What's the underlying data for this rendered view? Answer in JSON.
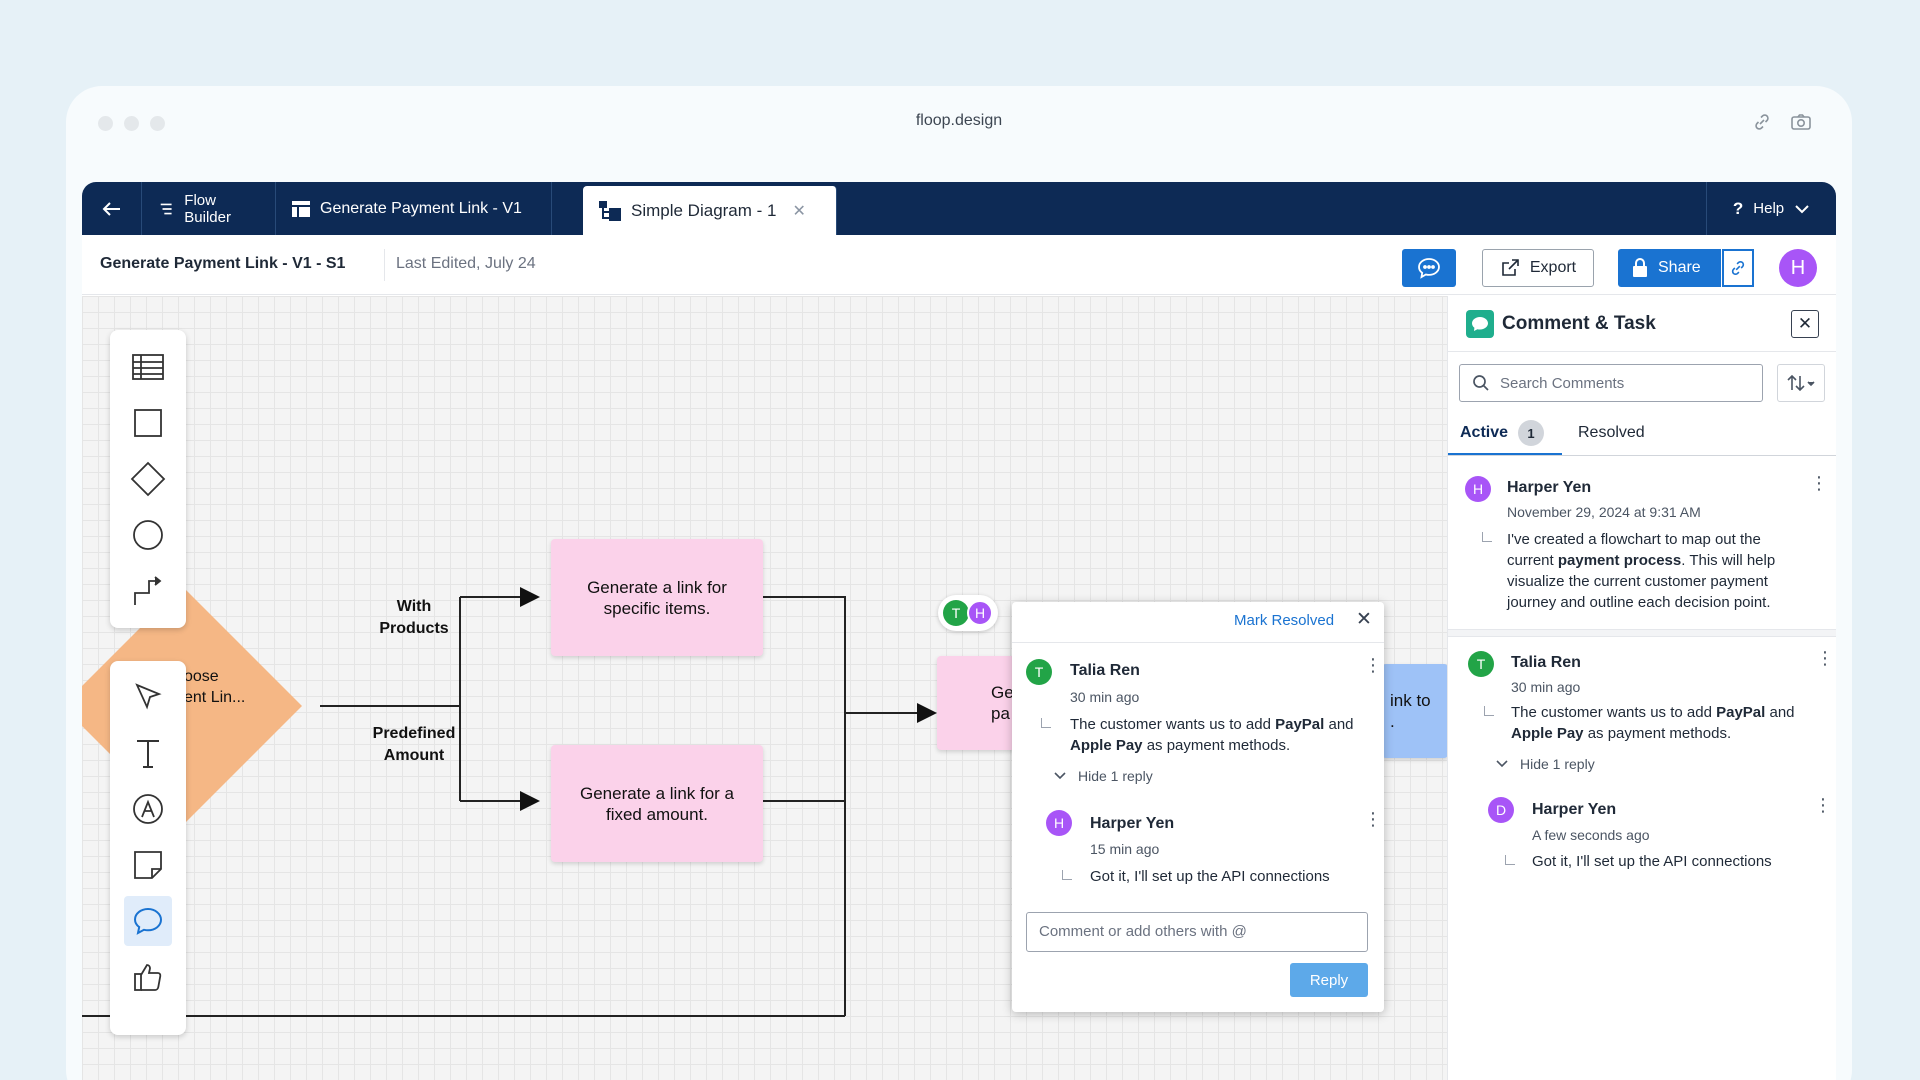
{
  "browser": {
    "url": "floop.design"
  },
  "nav": {
    "flow_builder": "Flow Builder",
    "tab1": "Generate Payment Link - V1",
    "tab2": "Simple Diagram - 1",
    "help": "Help"
  },
  "toolbar": {
    "doc_title": "Generate Payment Link - V1 - S1",
    "last_edited": "Last Edited, July 24",
    "export": "Export",
    "share": "Share",
    "user_initial": "H"
  },
  "diagram": {
    "decision": "Choose Payment Lin...",
    "decision_line1": "oose",
    "decision_line2": "ent Lin...",
    "label_with_products": "With Products",
    "label_with_products_1": "With",
    "label_with_products_2": "Products",
    "label_predefined_1": "Predefined",
    "label_predefined_2": "Amount",
    "node_items": "Generate a link for specific items.",
    "node_fixed": "Generate a link for a fixed amount.",
    "node_partial_1": "Ge",
    "node_partial_2": "pa",
    "node_blue_1": "ink to",
    "node_blue_2": ".",
    "presence": [
      "T",
      "H"
    ]
  },
  "popup": {
    "mark_resolved": "Mark Resolved",
    "c1": {
      "initial": "T",
      "name": "Talia Ren",
      "time": "30 min ago"
    },
    "c1_text_a": "The customer wants us to add ",
    "c1_text_b": "PayPal",
    "c1_text_c": " and ",
    "c1_text_d": "Apple Pay",
    "c1_text_e": " as payment methods.",
    "hide_reply": "Hide 1 reply",
    "c2": {
      "initial": "H",
      "name": "Harper Yen",
      "time": "15 min ago",
      "text": "Got it, I'll set up the API connections"
    },
    "reply_placeholder": "Comment or add others with @",
    "reply": "Reply"
  },
  "panel": {
    "title": "Comment & Task",
    "search_placeholder": "Search Comments",
    "tab_active": "Active",
    "active_count": "1",
    "tab_resolved": "Resolved",
    "t1": {
      "initial": "H",
      "name": "Harper Yen",
      "time": "November 29, 2024 at 9:31 AM"
    },
    "t1_text_a": "I've created a flowchart to map out the current ",
    "t1_text_b": "payment process",
    "t1_text_c": ". This will help visualize the current customer payment journey and outline each decision point.",
    "t2": {
      "initial": "T",
      "name": "Talia Ren",
      "time": "30 min ago"
    },
    "t2_text_a": "The customer wants us to add ",
    "t2_text_b": "PayPal",
    "t2_text_c": " and ",
    "t2_text_d": "Apple Pay",
    "t2_text_e": " as payment methods.",
    "hide_reply": "Hide 1 reply",
    "t3": {
      "initial": "D",
      "name": "Harper Yen",
      "time": "A few seconds ago",
      "text": "Got it, I'll set up the API connections"
    }
  },
  "colors": {
    "navy": "#0d2a55",
    "accent": "#1a73d1",
    "node_pink": "#fbd2ea",
    "decision_orange": "#f5b785",
    "node_blue": "#9ec2f7"
  }
}
